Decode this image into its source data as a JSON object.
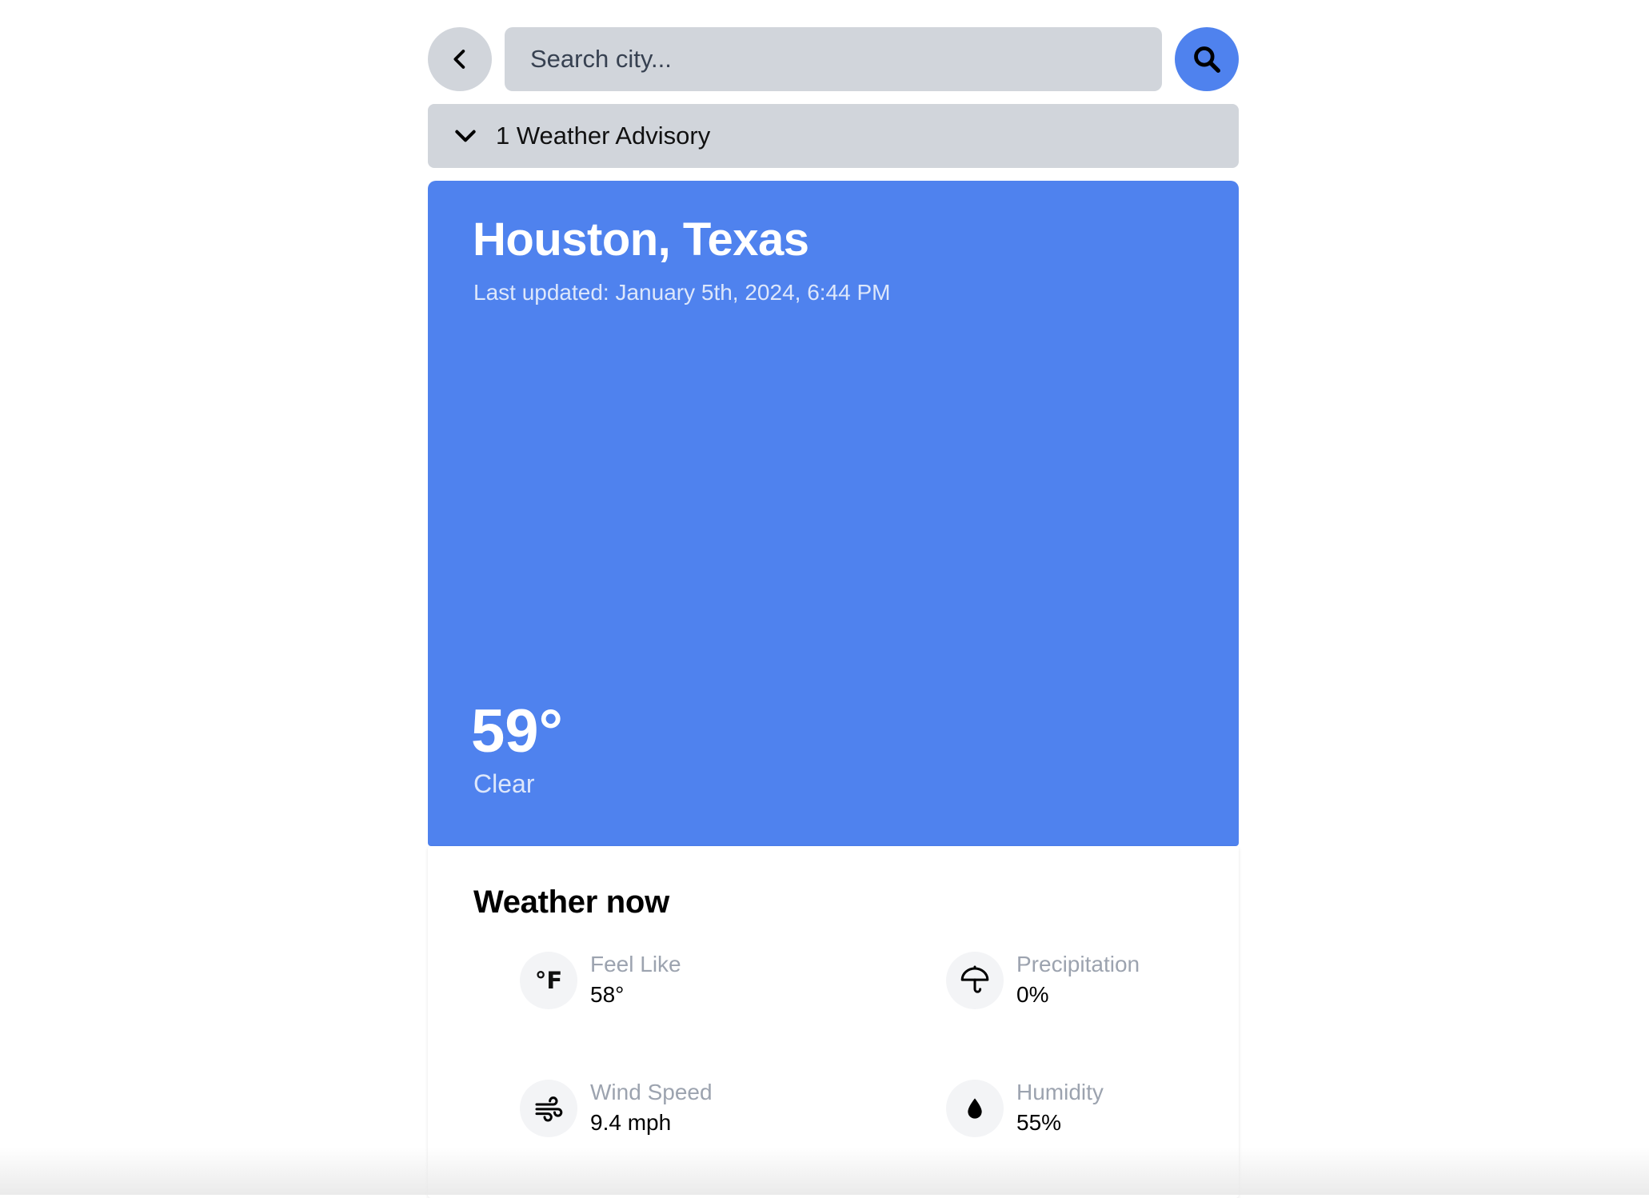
{
  "search": {
    "placeholder": "Search city..."
  },
  "advisory": {
    "label": "1 Weather Advisory"
  },
  "location": {
    "city": "Houston, Texas",
    "last_updated": "Last updated: January 5th, 2024, 6:44 PM"
  },
  "current": {
    "temperature": "59°",
    "condition": "Clear"
  },
  "weather_now": {
    "title": "Weather now",
    "feels_like": {
      "label": "Feel Like",
      "value": "58°",
      "icon_text": "°F"
    },
    "precipitation": {
      "label": "Precipitation",
      "value": "0%"
    },
    "wind_speed": {
      "label": "Wind Speed",
      "value": "9.4 mph"
    },
    "humidity": {
      "label": "Humidity",
      "value": "55%"
    }
  },
  "colors": {
    "accent": "#4f82ee",
    "control_gray": "#d1d5db",
    "muted_text": "#9ca3af"
  },
  "icons": {
    "back": "chevron-left-icon",
    "search": "magnifier-icon",
    "advisory_toggle": "chevron-down-icon",
    "feels_like": "fahrenheit-icon",
    "precipitation": "umbrella-icon",
    "wind_speed": "wind-icon",
    "humidity": "droplet-icon"
  }
}
